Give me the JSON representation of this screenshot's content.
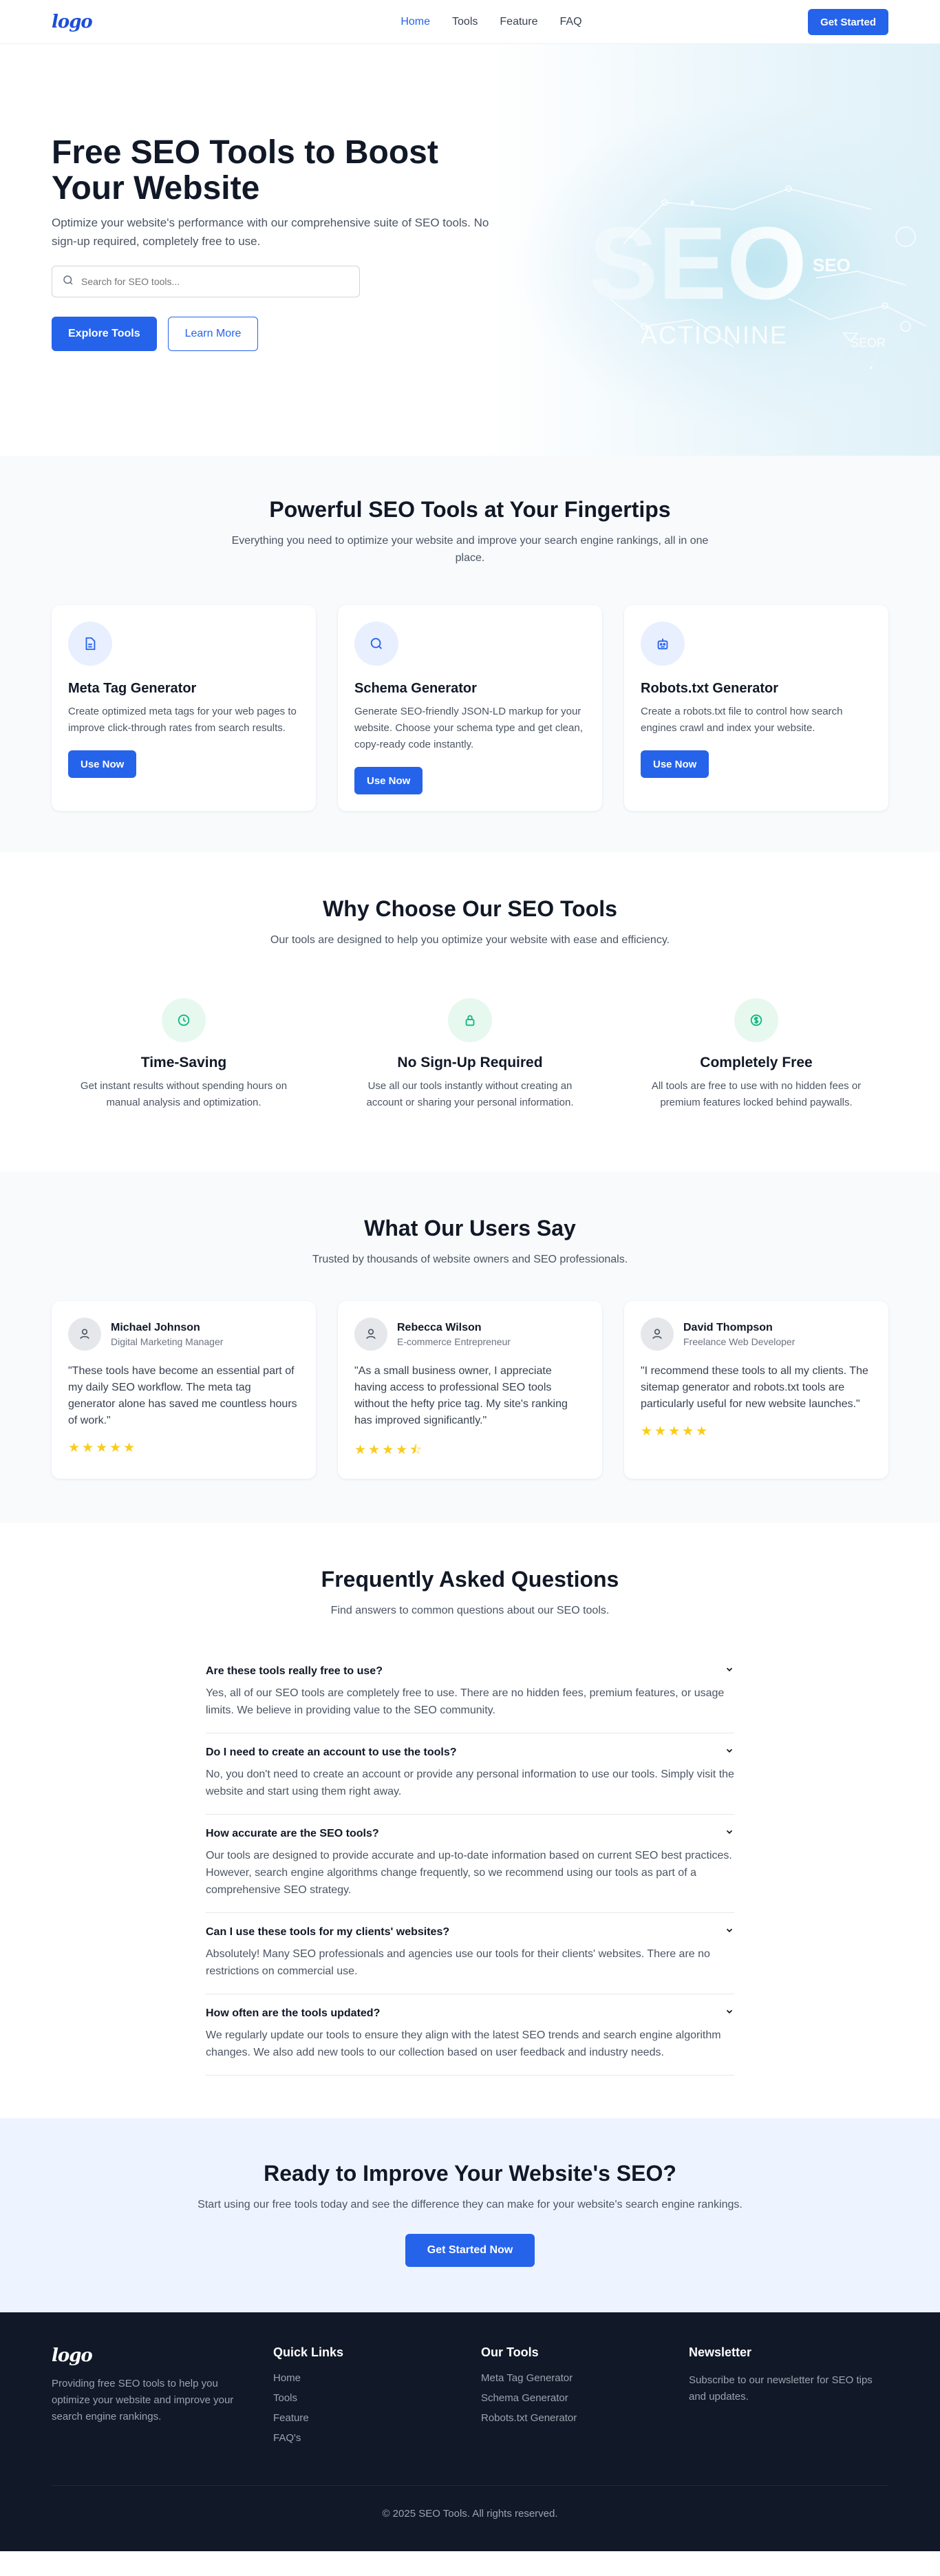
{
  "nav": {
    "logo": "logo",
    "links": [
      "Home",
      "Tools",
      "Feature",
      "FAQ"
    ],
    "cta": "Get Started"
  },
  "hero": {
    "title": "Free SEO Tools to Boost Your Website",
    "subtitle": "Optimize your website's performance with our comprehensive suite of SEO tools. No sign-up required, completely free to use.",
    "search_placeholder": "Search for SEO tools...",
    "primary_btn": "Explore Tools",
    "secondary_btn": "Learn More",
    "art": {
      "main": "SEO",
      "sub": "ACTIONINE",
      "tag1": "SEO",
      "tag2": "SEOR"
    }
  },
  "tools": {
    "title": "Powerful SEO Tools at Your Fingertips",
    "subtitle": "Everything you need to optimize your website and improve your search engine rankings, all in one place.",
    "items": [
      {
        "icon": "document-icon",
        "name": "Meta Tag Generator",
        "desc": "Create optimized meta tags for your web pages to improve click-through rates from search results.",
        "btn": "Use Now"
      },
      {
        "icon": "search-icon",
        "name": "Schema Generator",
        "desc": "Generate SEO-friendly JSON-LD markup for your website. Choose your schema type and get clean, copy-ready code instantly.",
        "btn": "Use Now"
      },
      {
        "icon": "robot-icon",
        "name": "Robots.txt Generator",
        "desc": "Create a robots.txt file to control how search engines crawl and index your website.",
        "btn": "Use Now"
      }
    ]
  },
  "why": {
    "title": "Why Choose Our SEO Tools",
    "subtitle": "Our tools are designed to help you optimize your website with ease and efficiency.",
    "items": [
      {
        "icon": "clock-icon",
        "name": "Time-Saving",
        "desc": "Get instant results without spending hours on manual analysis and optimization."
      },
      {
        "icon": "lock-icon",
        "name": "No Sign-Up Required",
        "desc": "Use all our tools instantly without creating an account or sharing your personal information."
      },
      {
        "icon": "dollar-icon",
        "name": "Completely Free",
        "desc": "All tools are free to use with no hidden fees or premium features locked behind paywalls."
      }
    ]
  },
  "testimonials": {
    "title": "What Our Users Say",
    "subtitle": "Trusted by thousands of website owners and SEO professionals.",
    "items": [
      {
        "name": "Michael Johnson",
        "role": "Digital Marketing Manager",
        "quote": "\"These tools have become an essential part of my daily SEO workflow. The meta tag generator alone has saved me countless hours of work.\"",
        "stars": "★★★★★"
      },
      {
        "name": "Rebecca Wilson",
        "role": "E-commerce Entrepreneur",
        "quote": "\"As a small business owner, I appreciate having access to professional SEO tools without the hefty price tag. My site's ranking has improved significantly.\"",
        "stars": "★★★★⯪"
      },
      {
        "name": "David Thompson",
        "role": "Freelance Web Developer",
        "quote": "\"I recommend these tools to all my clients. The sitemap generator and robots.txt tools are particularly useful for new website launches.\"",
        "stars": "★★★★★"
      }
    ]
  },
  "faq": {
    "title": "Frequently Asked Questions",
    "subtitle": "Find answers to common questions about our SEO tools.",
    "items": [
      {
        "q": "Are these tools really free to use?",
        "a": "Yes, all of our SEO tools are completely free to use. There are no hidden fees, premium features, or usage limits. We believe in providing value to the SEO community."
      },
      {
        "q": "Do I need to create an account to use the tools?",
        "a": "No, you don't need to create an account or provide any personal information to use our tools. Simply visit the website and start using them right away."
      },
      {
        "q": "How accurate are the SEO tools?",
        "a": "Our tools are designed to provide accurate and up-to-date information based on current SEO best practices. However, search engine algorithms change frequently, so we recommend using our tools as part of a comprehensive SEO strategy."
      },
      {
        "q": "Can I use these tools for my clients' websites?",
        "a": "Absolutely! Many SEO professionals and agencies use our tools for their clients' websites. There are no restrictions on commercial use."
      },
      {
        "q": "How often are the tools updated?",
        "a": "We regularly update our tools to ensure they align with the latest SEO trends and search engine algorithm changes. We also add new tools to our collection based on user feedback and industry needs."
      }
    ]
  },
  "cta": {
    "title": "Ready to Improve Your Website's SEO?",
    "subtitle": "Start using our free tools today and see the difference they can make for your website's search engine rankings.",
    "btn": "Get Started Now"
  },
  "footer": {
    "logo": "logo",
    "desc": "Providing free SEO tools to help you optimize your website and improve your search engine rankings.",
    "quick_title": "Quick Links",
    "quick_links": [
      "Home",
      "Tools",
      "Feature",
      "FAQ's"
    ],
    "tools_title": "Our Tools",
    "tools_links": [
      "Meta Tag Generator",
      "Schema Generator",
      "Robots.txt Generator"
    ],
    "news_title": "Newsletter",
    "news_desc": "Subscribe to our newsletter for SEO tips and updates.",
    "copyright": "© 2025 SEO Tools. All rights reserved."
  },
  "colors": {
    "primary": "#2563eb",
    "dark": "#111827",
    "star": "#facc15",
    "green": "#10b981"
  }
}
